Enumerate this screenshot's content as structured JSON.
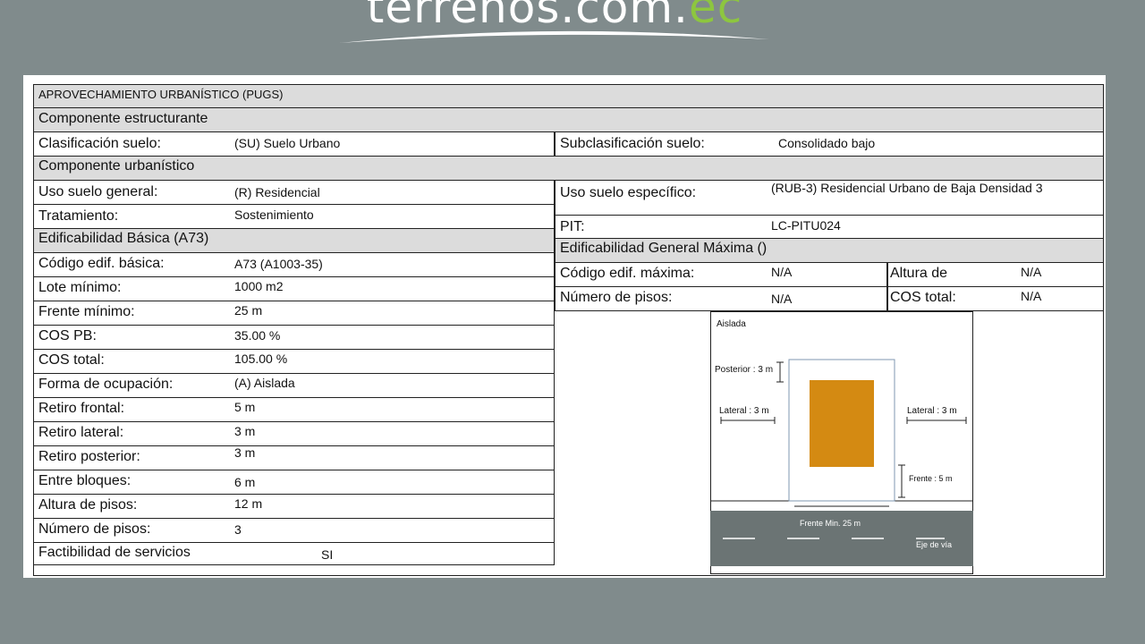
{
  "logo": {
    "main": "terrenos.com.",
    "accent": "ec"
  },
  "doc": {
    "title": "APROVECHAMIENTO URBANÍSTICO (PUGS)",
    "componente_estructurante": "Componente  estructurante",
    "clasificacion_label": "Clasificación suelo:",
    "clasificacion_value": "(SU) Suelo Urbano",
    "subclasificacion_label": "Subclasificación suelo:",
    "subclasificacion_value": "Consolidado bajo",
    "componente_urbanistico": "Componente  urbanístico",
    "uso_general_label": "Uso suelo general:",
    "uso_general_value": "(R) Residencial",
    "uso_especifico_label": "Uso suelo específico:",
    "uso_especifico_value": "(RUB-3) Residencial Urbano de Baja Densidad 3",
    "tratamiento_label": "Tratamiento:",
    "tratamiento_value": "Sostenimiento",
    "pit_label": "PIT:",
    "pit_value": "LC-PITU024",
    "edif_basica": "Edificabilidad Básica (A73)",
    "edif_max": "Edificabilidad General Máxima ()",
    "codigo_max_label": "Código edif. máxima:",
    "codigo_max_value": "N/A",
    "altura_de_label": "Altura de",
    "altura_de_value": "N/A",
    "num_pisos_max_label": "Número de pisos:",
    "num_pisos_max_value": "N/A",
    "cos_total_max_label": "COS total:",
    "cos_total_max_value": "N/A",
    "rows": [
      {
        "label": "Código edif. básica:",
        "value": "A73 (A1003-35)"
      },
      {
        "label": "Lote mínimo:",
        "value": "1000 m2"
      },
      {
        "label": "Frente mínimo:",
        "value": "25 m"
      },
      {
        "label": "COS PB:",
        "value": "35.00 %"
      },
      {
        "label": "COS total:",
        "value": "105.00 %"
      },
      {
        "label": "Forma de ocupación:",
        "value": "(A) Aislada"
      },
      {
        "label": "Retiro frontal:",
        "value": "5 m"
      },
      {
        "label": "Retiro lateral:",
        "value": "3 m"
      },
      {
        "label": "Retiro posterior:",
        "value": "3 m"
      },
      {
        "label": "Entre bloques:",
        "value": "6 m"
      },
      {
        "label": "Altura de pisos:",
        "value": "12 m"
      },
      {
        "label": "Número de pisos:",
        "value": "3"
      }
    ],
    "factibilidad_label": "Factibilidad de servicios",
    "factibilidad_value": "SI"
  },
  "diagram": {
    "title": "Aislada",
    "posterior": "Posterior : 3 m",
    "lateral_left": "Lateral : 3 m",
    "lateral_right": "Lateral : 3 m",
    "frente": "Frente : 5 m",
    "frente_min": "Frente Min. 25 m",
    "eje_via": "Eje de vía",
    "colors": {
      "building": "#d48a12",
      "road": "#6b7474"
    }
  }
}
